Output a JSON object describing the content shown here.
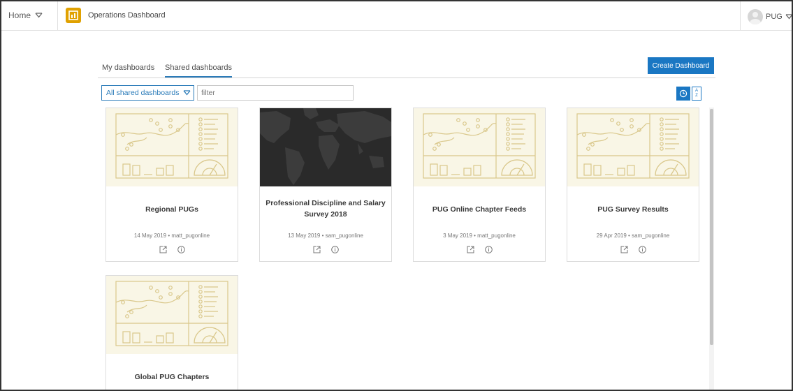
{
  "topbar": {
    "home_label": "Home",
    "app_title": "Operations Dashboard",
    "user_label": "PUG"
  },
  "tabs": [
    {
      "label": "My dashboards",
      "active": false
    },
    {
      "label": "Shared dashboards",
      "active": true
    }
  ],
  "create_button": "Create Dashboard",
  "filter": {
    "select_value": "All shared dashboards",
    "placeholder": "filter"
  },
  "sort": {
    "time_icon": "clock-icon",
    "alpha_icon": "sort-az-icon",
    "alpha_label": "A Z"
  },
  "colors": {
    "accent": "#1a77c3",
    "thumb_bg": "#f9f6e6",
    "thumb_line": "#d9c78a"
  },
  "cards": [
    {
      "title": "Regional PUGs",
      "date": "14 May 2019",
      "owner": "matt_pugonline",
      "thumbnail": "dashboard-placeholder"
    },
    {
      "title": "Professional Discipline and Salary Survey 2018",
      "date": "13 May 2019",
      "owner": "sam_pugonline",
      "thumbnail": "dark-world-map"
    },
    {
      "title": "PUG Online Chapter Feeds",
      "date": "3 May 2019",
      "owner": "matt_pugonline",
      "thumbnail": "dashboard-placeholder"
    },
    {
      "title": "PUG Survey Results",
      "date": "29 Apr 2019",
      "owner": "sam_pugonline",
      "thumbnail": "dashboard-placeholder"
    },
    {
      "title": "Global PUG Chapters",
      "date": "",
      "owner": "",
      "thumbnail": "dashboard-placeholder"
    }
  ]
}
